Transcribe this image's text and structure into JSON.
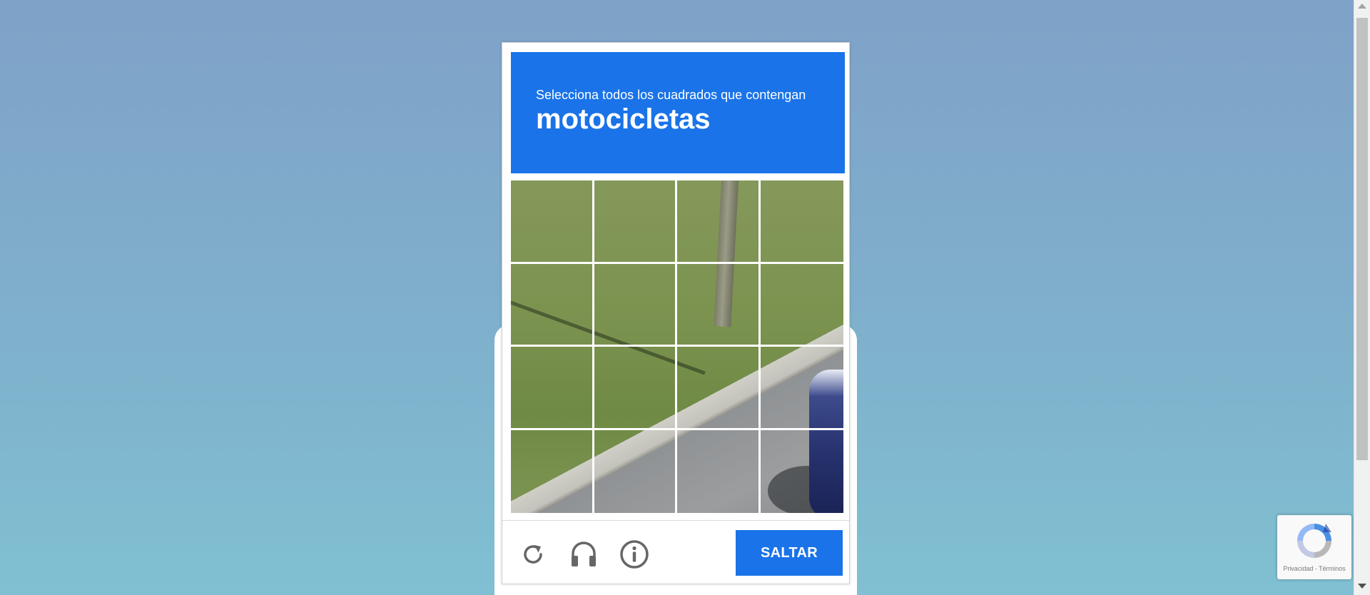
{
  "captcha": {
    "prompt_intro": "Selecciona todos los cuadrados que contengan",
    "prompt_object": "motocicletas",
    "grid": {
      "rows": 4,
      "columns": 4
    },
    "icons": [
      "reload-icon",
      "headphones-icon",
      "info-icon"
    ],
    "skip_button_label": "SALTAR",
    "accent_color": "#1a73e8"
  },
  "recaptcha_badge": {
    "links_text": "Privacidad - Términos"
  }
}
